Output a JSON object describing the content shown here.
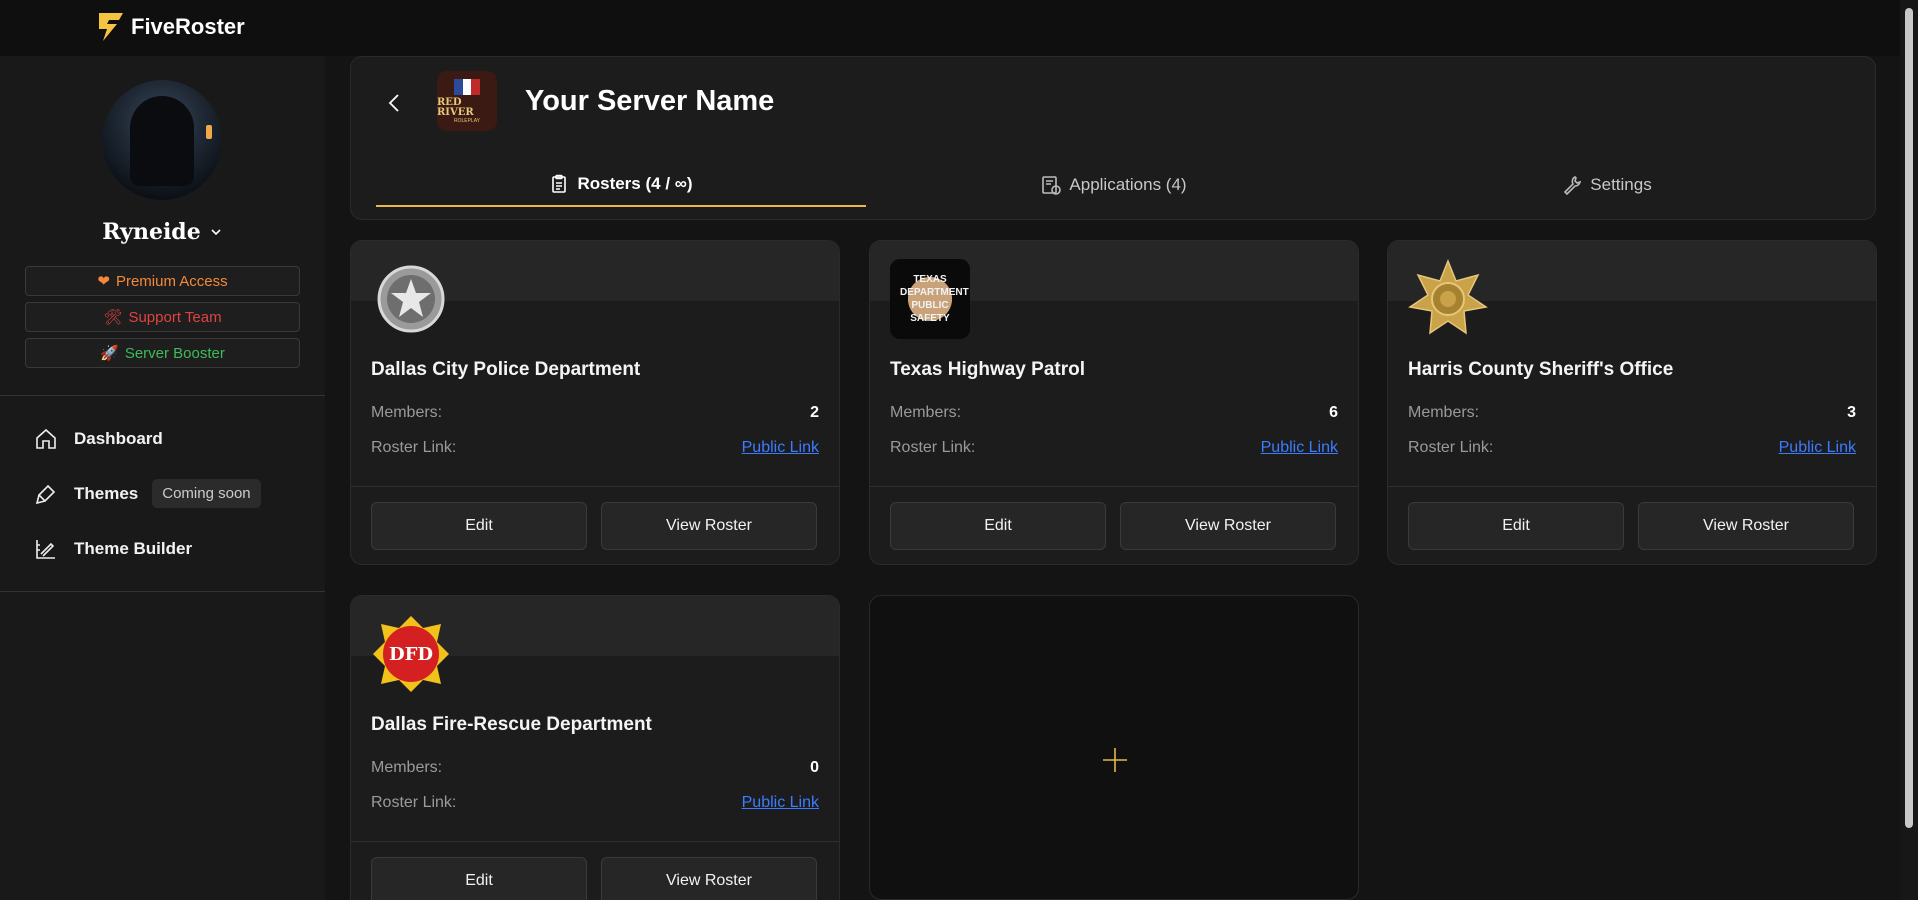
{
  "app": {
    "brand": "FiveRoster"
  },
  "user": {
    "name": "Ryneide"
  },
  "badges": [
    {
      "label": "Premium Access",
      "icon": "heart-icon",
      "color": "#f5883a"
    },
    {
      "label": "Support Team",
      "icon": "tools-icon",
      "color": "#e04242"
    },
    {
      "label": "Server Booster",
      "icon": "rocket-icon",
      "color": "#3dbb5a"
    }
  ],
  "nav": {
    "dashboard": "Dashboard",
    "themes": "Themes",
    "themes_badge": "Coming soon",
    "theme_builder": "Theme Builder"
  },
  "server": {
    "name": "Your Server Name",
    "logo_text": "RED RIVER",
    "logo_sub": "ROLEPLAY"
  },
  "tabs": [
    {
      "label": "Rosters (4 / ∞)",
      "active": true
    },
    {
      "label": "Applications (4)",
      "active": false
    },
    {
      "label": "Settings",
      "active": false
    }
  ],
  "rosters": [
    {
      "name": "Dallas City Police Department",
      "members_label": "Members:",
      "members": "2",
      "link_label": "Roster Link:",
      "link_text": "Public Link",
      "edit": "Edit",
      "view": "View Roster"
    },
    {
      "name": "Texas Highway Patrol",
      "members_label": "Members:",
      "members": "6",
      "link_label": "Roster Link:",
      "link_text": "Public Link",
      "edit": "Edit",
      "view": "View Roster",
      "logo_text": "TEXAS DEPARTMENT PUBLIC SAFETY"
    },
    {
      "name": "Harris County Sheriff's Office",
      "members_label": "Members:",
      "members": "3",
      "link_label": "Roster Link:",
      "link_text": "Public Link",
      "edit": "Edit",
      "view": "View Roster"
    },
    {
      "name": "Dallas Fire-Rescue Department",
      "members_label": "Members:",
      "members": "0",
      "link_label": "Roster Link:",
      "link_text": "Public Link",
      "edit": "Edit",
      "view": "View Roster",
      "logo_text": "DFD"
    }
  ],
  "colors": {
    "accent": "#e8b84a",
    "link": "#3d7bff",
    "card_bg": "#1c1c1c"
  }
}
